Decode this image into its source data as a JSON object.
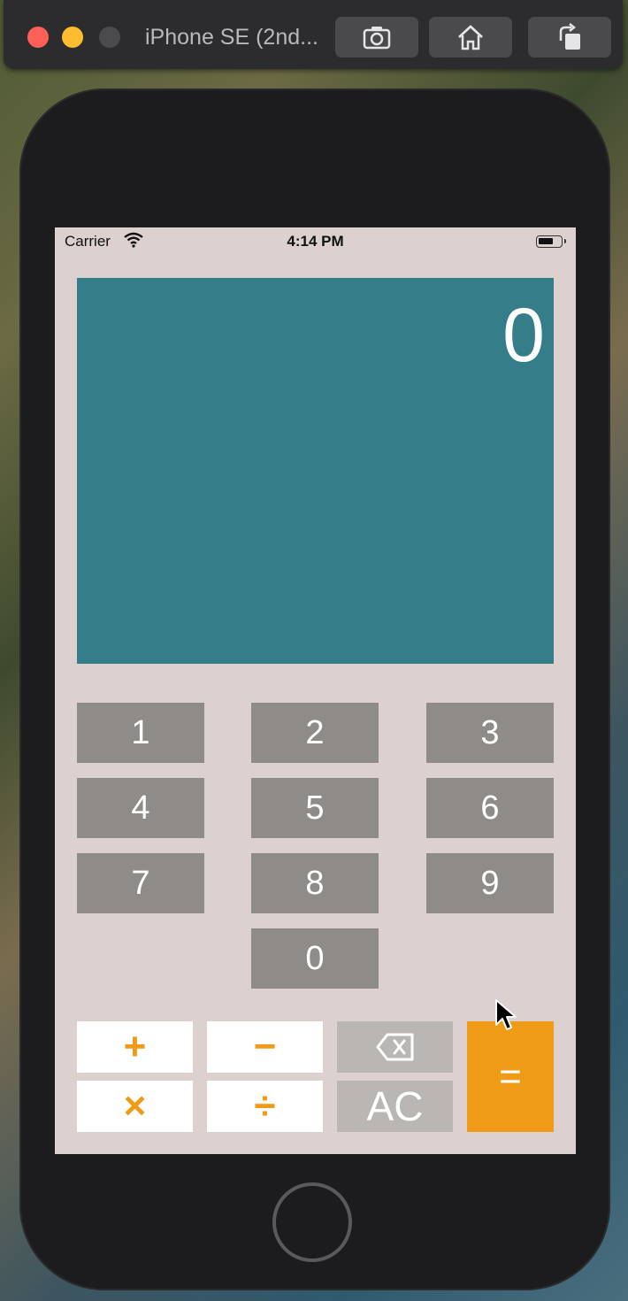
{
  "simulator": {
    "title": "iPhone SE (2nd...",
    "screenshot_icon": "camera-icon",
    "home_icon": "home-icon",
    "rotate_icon": "rotate-icon"
  },
  "status_bar": {
    "carrier": "Carrier",
    "time": "4:14 PM"
  },
  "display": {
    "value": "0"
  },
  "keypad": {
    "digits": [
      "1",
      "2",
      "3",
      "4",
      "5",
      "6",
      "7",
      "8",
      "9",
      "0"
    ]
  },
  "operators": {
    "plus": "+",
    "minus": "−",
    "multiply": "×",
    "divide": "÷",
    "equals": "=",
    "clear": "AC",
    "backspace_icon": "delete-backward-icon"
  },
  "colors": {
    "display_bg": "#347d89",
    "screen_bg": "#ddd1cf",
    "digit_key": "#8f8b88",
    "accent": "#ef9b17",
    "function_key": "#b9b6b4"
  }
}
